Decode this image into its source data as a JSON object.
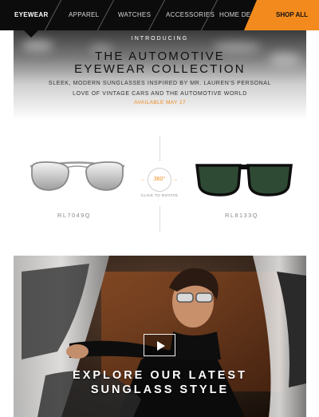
{
  "nav": {
    "items": [
      "EYEWEAR",
      "APPAREL",
      "WATCHES",
      "ACCESSORIES",
      "HOME DECOR"
    ],
    "active_index": 0,
    "shop_all_label": "SHOP ALL"
  },
  "hero": {
    "intro": "INTRODUCING",
    "title_line1": "THE AUTOMOTIVE",
    "title_line2": "EYEWEAR COLLECTION",
    "subtitle_line1": "SLEEK, MODERN SUNGLASSES INSPIRED BY MR. LAUREN'S PERSONAL",
    "subtitle_line2": "LOVE OF VINTAGE CARS AND THE AUTOMOTIVE WORLD",
    "availability": "AVAILABLE MAY 27"
  },
  "products": [
    {
      "code": "RL7049Q",
      "frame": "silver aviator",
      "lens": "mirrored silver"
    },
    {
      "code": "RL8133Q",
      "frame": "black square",
      "lens": "green"
    }
  ],
  "rotate": {
    "badge": "360°",
    "label": "CLICK TO ROTATE"
  },
  "scene": {
    "headline_line1": "EXPLORE OUR LATEST",
    "headline_line2": "SUNGLASS STYLE",
    "play_icon": "play-icon"
  },
  "colors": {
    "accent": "#f28a1e",
    "nav_bg": "#0c0c0c"
  }
}
